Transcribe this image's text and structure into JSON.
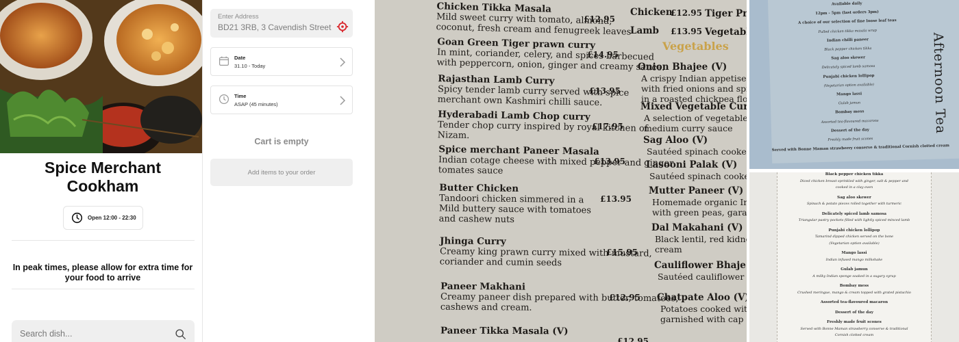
{
  "store": {
    "name": "Spice Merchant Cookham",
    "hours": "Open 12:00 - 22:30",
    "notice": "In peak times, please allow for extra time for your food to arrive"
  },
  "search": {
    "placeholder": "Search dish..."
  },
  "order": {
    "address_label": "Enter Address",
    "address_value": "BD21 3RB, 3 Cavendish Street",
    "date_label": "Date",
    "date_value": "31.10 - Today",
    "time_label": "Time",
    "time_value": "ASAP (45 minutes)",
    "cart_empty": "Cart is empty",
    "add_items_label": "Add items to your order"
  },
  "menu_photo": {
    "left_items": [
      {
        "name": "Chicken Tikka Masala",
        "price": "£12.95",
        "desc": [
          "Mild sweet curry with tomato, almond,",
          "coconut, fresh cream and fenugreek leaves"
        ]
      },
      {
        "name": "Goan Green Tiger prawn curry",
        "price": "£14.95",
        "desc": [
          "In mint, coriander, celery, and spices barbecued",
          "with peppercorn, onion, ginger and creamy sauce."
        ]
      },
      {
        "name": "Rajasthan Lamb Curry",
        "price": "£13.95",
        "desc": [
          "Spicy tender lamb curry served with spice",
          "merchant own Kashmiri chilli sauce."
        ]
      },
      {
        "name": "Hyderabadi Lamb Chop curry",
        "price": "£17.95",
        "desc": [
          "Tender chop curry inspired by royal kitchen of",
          "Nizam."
        ]
      },
      {
        "name": "Spice merchant Paneer Masala",
        "price": "£13.95",
        "desc": [
          "Indian cotage cheese with mixed pepper and ginger",
          "tomates sauce"
        ]
      },
      {
        "name": "Butter Chicken",
        "price": "£13.95",
        "desc": [
          "Tandoori chicken simmered in a",
          "Mild buttery sauce with tomatoes",
          "and cashew nuts"
        ]
      },
      {
        "name": "Jhinga Curry",
        "price": "£15.95",
        "desc": [
          "Creamy king prawn curry mixed with mustard,",
          "coriander and cumin seeds"
        ]
      },
      {
        "name": "Paneer Makhani",
        "price": "£12.95",
        "desc": [
          "Creamy paneer dish prepared with butter, tomatoes,",
          "cashews and cream."
        ]
      },
      {
        "name": "Paneer Tikka Masala (V)",
        "price": "£12.95",
        "desc": []
      }
    ],
    "top_row": [
      {
        "name": "Chicken",
        "price": "£12.95",
        "extra": "Tiger Prawn"
      },
      {
        "name": "Lamb",
        "price": "£13.95",
        "extra": "Vegetable"
      }
    ],
    "veg_heading": "Vegetables",
    "right_items": [
      {
        "name": "Onion Bhajee (V)",
        "desc": [
          "A crispy Indian appetiser packed",
          "with fried onions and spices rolled",
          "in a roasted chickpea flour"
        ]
      },
      {
        "name": "Mixed Vegetable Curry (V)",
        "desc": [
          "A selection of vegetables cooked",
          "medium curry sauce"
        ]
      },
      {
        "name": "Sag Aloo (V)",
        "desc": [
          "Sautéed spinach cooked with"
        ]
      },
      {
        "name": "Lasooni Palak (V)",
        "desc": [
          "Sautéed spinach cooked with"
        ]
      },
      {
        "name": "Mutter Paneer (V)",
        "desc": [
          "Homemade organic Indian",
          "with green peas, garam ma"
        ]
      },
      {
        "name": "Dal Makahani (V)",
        "desc": [
          "Black lentil, red kidney b",
          "cream"
        ]
      },
      {
        "name": "Cauliflower Bhaje",
        "desc": [
          "Sautéed cauliflower co"
        ]
      },
      {
        "name": "Chatpate Aloo (V)",
        "desc": [
          "Potatoes cooked with",
          "garnished with cap"
        ]
      }
    ]
  },
  "tea_photo": {
    "title": "Afternoon Tea",
    "top_lines": [
      "Available daily",
      "12pm - 5pm (last orders 3pm)",
      "A choice of our selection of fine loose leaf teas",
      "Pulled chicken tikka masala wrap",
      "Indian chilli paneer",
      "Black pepper chicken tikka",
      "Sag aloo skewer",
      "Delicately spiced lamb samosa",
      "Punjabi chicken lollipop",
      "(Vegetarian option available)",
      "Mango lassi",
      "Gulab jamun",
      "Bombay mess",
      "Assorted tea-flavoured macarons",
      "Dessert of the day",
      "Freshly made fruit scones",
      "Served with Bonne Maman strawberry conserve & traditional Cornish clotted cream"
    ],
    "bottom_lines": [
      {
        "t": "Black pepper chicken tikka",
        "s": "b"
      },
      {
        "t": "Diced chicken breast sprinkled with ginger, salt & pepper and",
        "s": "i"
      },
      {
        "t": "cooked in a clay oven",
        "s": "i"
      },
      {
        "t": "Sag aloo skewer",
        "s": "b"
      },
      {
        "t": "Spinach & potato pieces rolled together with turmeric",
        "s": "i"
      },
      {
        "t": "Delicately spiced lamb samosa",
        "s": "b"
      },
      {
        "t": "Triangular pastry pockets filled with lightly spiced minced lamb",
        "s": "i"
      },
      {
        "t": "Punjabi chicken lollipop",
        "s": "b"
      },
      {
        "t": "Tamarind dipped chicken served on the bone",
        "s": "i"
      },
      {
        "t": "(Vegetarian option available)",
        "s": "i"
      },
      {
        "t": "Mango lassi",
        "s": "b"
      },
      {
        "t": "Indian infused mango milkshake",
        "s": "i"
      },
      {
        "t": "Gulab jamun",
        "s": "b"
      },
      {
        "t": "A milky Indian sponge soaked in a sugary syrup",
        "s": "i"
      },
      {
        "t": "Bombay mess",
        "s": "b"
      },
      {
        "t": "Crushed meringue, mango & cream topped with grated pistachio",
        "s": "i"
      },
      {
        "t": "Assorted tea-flavoured macaron",
        "s": "b"
      },
      {
        "t": "Dessert of the day",
        "s": "b"
      },
      {
        "t": "Freshly made fruit scones",
        "s": "b"
      },
      {
        "t": "Served with Bonne Maman strawberry conserve & traditional",
        "s": "i"
      },
      {
        "t": "Cornish clotted cream",
        "s": "i"
      }
    ]
  },
  "icons": {
    "clock": "clock-icon",
    "search": "search-icon",
    "location": "location-target-icon",
    "calendar": "calendar-icon",
    "chevron": "chevron-right-icon"
  },
  "colors": {
    "target_accent": "#d9262c",
    "muted_text": "#8a8a8a",
    "field_bg": "#efefef"
  }
}
